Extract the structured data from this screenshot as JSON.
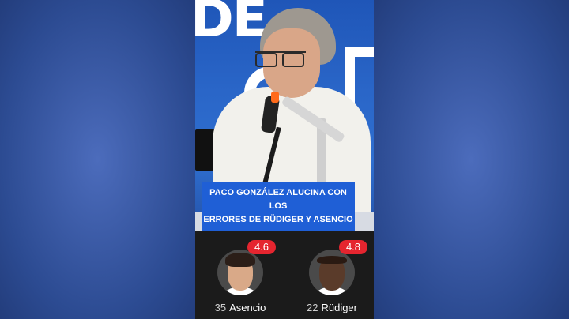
{
  "caption": {
    "line1": "PACO GONZÁLEZ ALUCINA CON LOS",
    "line2": "ERRORES DE RÜDIGER Y ASENCIO"
  },
  "studio": {
    "letters": "DE"
  },
  "players": [
    {
      "number": "35",
      "name": "Asencio",
      "rating": "4.6"
    },
    {
      "number": "22",
      "name": "Rüdiger",
      "rating": "4.8"
    }
  ],
  "colors": {
    "caption_bg": "#1f5fd6",
    "rating_badge": "#e5252f",
    "ratings_bg": "#1b1b1b",
    "side_bg": "#3d62b0"
  }
}
